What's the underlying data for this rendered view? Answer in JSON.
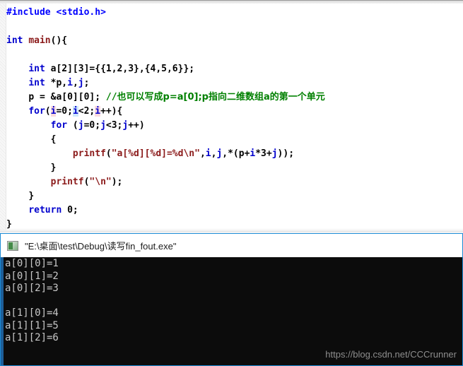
{
  "editor": {
    "name": "source-code-editor",
    "colors": {
      "background": "#ffffff",
      "keyword": "#0000cd",
      "preprocessor": "#0000ff",
      "function": "#8b1a1a",
      "string": "#8b1a1a",
      "comment": "#008000",
      "highlight_pink": "#fadadd",
      "highlight_blue": "#cfe8fb"
    },
    "lines": [
      {
        "indent": 0,
        "tokens": [
          {
            "t": "#include ",
            "c": "pre"
          },
          {
            "t": "<stdio.h>",
            "c": "pre"
          }
        ]
      },
      {
        "indent": 0,
        "tokens": []
      },
      {
        "indent": 0,
        "tokens": [
          {
            "t": "int ",
            "c": "kw"
          },
          {
            "t": "main",
            "c": "fn"
          },
          {
            "t": "(){",
            "c": "plain"
          }
        ]
      },
      {
        "indent": 0,
        "tokens": []
      },
      {
        "indent": 1,
        "tokens": [
          {
            "t": "int ",
            "c": "kw"
          },
          {
            "t": "a[2][3]={{1,2,3},{4,5,6}};",
            "c": "plain"
          }
        ]
      },
      {
        "indent": 1,
        "tokens": [
          {
            "t": "int ",
            "c": "kw"
          },
          {
            "t": "*p,",
            "c": "plain"
          },
          {
            "t": "i",
            "c": "ident"
          },
          {
            "t": ",",
            "c": "plain"
          },
          {
            "t": "j",
            "c": "ident"
          },
          {
            "t": ";",
            "c": "plain"
          }
        ]
      },
      {
        "indent": 1,
        "tokens": [
          {
            "t": "p = &a[0][0]; ",
            "c": "plain"
          },
          {
            "t": "//",
            "c": "comment-slash"
          },
          {
            "t": "也可以写成p=a[0];p指向二维数组a的第一个单元",
            "c": "comment"
          }
        ]
      },
      {
        "indent": 1,
        "tokens": [
          {
            "t": "for",
            "c": "kw"
          },
          {
            "t": "(",
            "c": "plain"
          },
          {
            "t": "i",
            "c": "ident",
            "hl": "pink"
          },
          {
            "t": "=0;",
            "c": "plain"
          },
          {
            "t": "i",
            "c": "ident",
            "hl": "blue"
          },
          {
            "t": "<2;",
            "c": "plain"
          },
          {
            "t": "i",
            "c": "ident",
            "hl": "pink"
          },
          {
            "t": "++){",
            "c": "plain"
          }
        ]
      },
      {
        "indent": 2,
        "tokens": [
          {
            "t": "for",
            "c": "kw"
          },
          {
            "t": " (",
            "c": "plain"
          },
          {
            "t": "j",
            "c": "ident"
          },
          {
            "t": "=0;",
            "c": "plain"
          },
          {
            "t": "j",
            "c": "ident"
          },
          {
            "t": "<3;",
            "c": "plain"
          },
          {
            "t": "j",
            "c": "ident"
          },
          {
            "t": "++)",
            "c": "plain"
          }
        ]
      },
      {
        "indent": 2,
        "tokens": [
          {
            "t": "{",
            "c": "plain"
          }
        ]
      },
      {
        "indent": 3,
        "tokens": [
          {
            "t": "printf",
            "c": "fn"
          },
          {
            "t": "(",
            "c": "plain"
          },
          {
            "t": "\"a[%d][%d]=%d\\n\"",
            "c": "str"
          },
          {
            "t": ",",
            "c": "plain"
          },
          {
            "t": "i",
            "c": "ident"
          },
          {
            "t": ",",
            "c": "plain"
          },
          {
            "t": "j",
            "c": "ident"
          },
          {
            "t": ",*(p+",
            "c": "plain"
          },
          {
            "t": "i",
            "c": "ident"
          },
          {
            "t": "*3+",
            "c": "plain"
          },
          {
            "t": "j",
            "c": "ident"
          },
          {
            "t": "));",
            "c": "plain"
          }
        ]
      },
      {
        "indent": 2,
        "tokens": [
          {
            "t": "}",
            "c": "plain"
          }
        ]
      },
      {
        "indent": 2,
        "tokens": [
          {
            "t": "printf",
            "c": "fn"
          },
          {
            "t": "(",
            "c": "plain"
          },
          {
            "t": "\"\\n\"",
            "c": "str"
          },
          {
            "t": ");",
            "c": "plain"
          }
        ]
      },
      {
        "indent": 1,
        "tokens": [
          {
            "t": "}",
            "c": "plain"
          }
        ]
      },
      {
        "indent": 1,
        "tokens": [
          {
            "t": "return ",
            "c": "kw"
          },
          {
            "t": "0;",
            "c": "plain"
          }
        ]
      },
      {
        "indent": 0,
        "tokens": [
          {
            "t": "}",
            "c": "plain"
          }
        ]
      }
    ]
  },
  "console": {
    "title": "\"E:\\桌面\\test\\Debug\\读写fin_fout.exe\"",
    "icon": "console-app-icon",
    "border_color": "#1a8ad4",
    "background": "#0c0c0c",
    "text_color": "#c8c8c8",
    "output_lines": [
      "a[0][0]=1",
      "a[0][1]=2",
      "a[0][2]=3",
      "",
      "a[1][0]=4",
      "a[1][1]=5",
      "a[1][2]=6",
      ""
    ]
  },
  "watermark": {
    "text": "https://blog.csdn.net/CCCrunner"
  }
}
